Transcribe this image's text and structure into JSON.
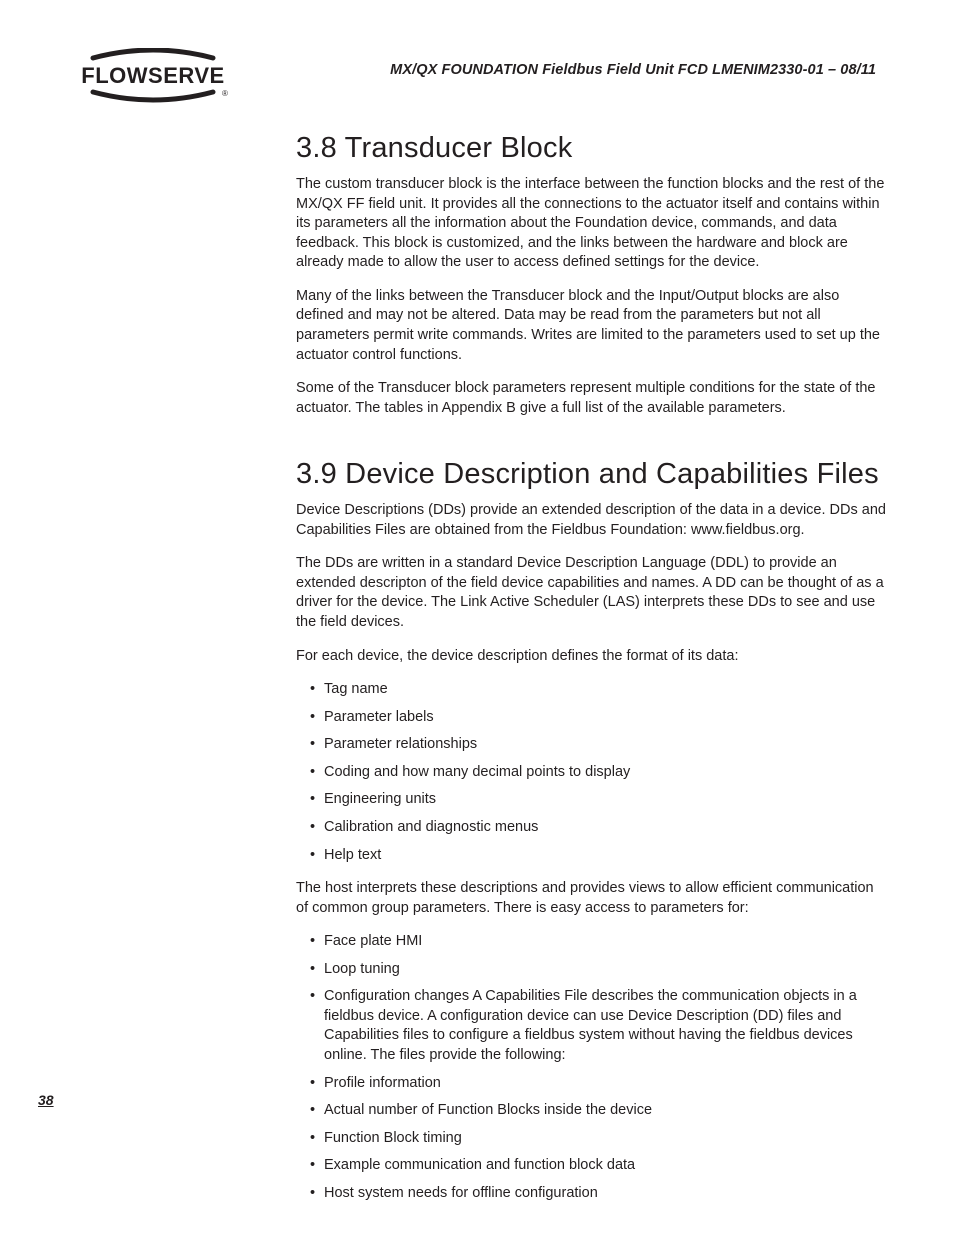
{
  "header": {
    "doc_title": "MX/QX FOUNDATION Fieldbus Field Unit   FCD LMENIM2330-01 – 08/11",
    "logo_text": "FLOWSERVE"
  },
  "page_number": "38",
  "section_38": {
    "heading": "3.8 Transducer Block",
    "p1": "The custom transducer block is the interface between the function blocks and the rest of the MX/QX FF field unit. It provides all the connections to the actuator itself and contains within its parameters all the information about the Foundation device, commands, and data feedback. This block is customized, and the links between the hardware and block are already made to allow the user to access defined settings for the device.",
    "p2": "Many of the links between the Transducer block and the Input/Output blocks are also defined and may not be altered. Data may be read from the parameters but not all parameters permit write commands. Writes are limited to the parameters used to set up the actuator control functions.",
    "p3": "Some of the Transducer block parameters represent multiple conditions for the state of the actuator. The tables in Appendix B give a full list of the available parameters."
  },
  "section_39": {
    "heading": "3.9 Device Description and Capabilities Files",
    "p1": "Device Descriptions (DDs) provide an extended description of the data in a device. DDs and Capabilities Files are obtained from the Fieldbus Foundation: www.fieldbus.org.",
    "p2": "The DDs are written in a standard Device Description Language (DDL) to provide an extended descripton of the field device capabilities and names. A DD can be thought of as a driver for the device. The Link Active Scheduler (LAS) interprets these DDs to see and use the field devices.",
    "p3": "For each device, the device description defines the format of its data:",
    "list1": [
      "Tag name",
      "Parameter labels",
      "Parameter relationships",
      "Coding and how many decimal points to display",
      "Engineering units",
      "Calibration and diagnostic menus",
      "Help text"
    ],
    "p4": "The host interprets these descriptions and provides views to allow efficient communication of common group parameters. There is easy access to parameters for:",
    "list2": [
      "Face plate HMI",
      "Loop tuning",
      "Configuration changes A Capabilities File describes the communication objects in a fieldbus device. A configuration device can use Device Description (DD) files and Capabilities files to configure a fieldbus system without having the fieldbus devices online. The files provide the following:",
      "Profile information",
      "Actual number of Function Blocks inside the device",
      "Function Block timing",
      "Example communication and function block data",
      "Host system needs for offline configuration"
    ]
  }
}
